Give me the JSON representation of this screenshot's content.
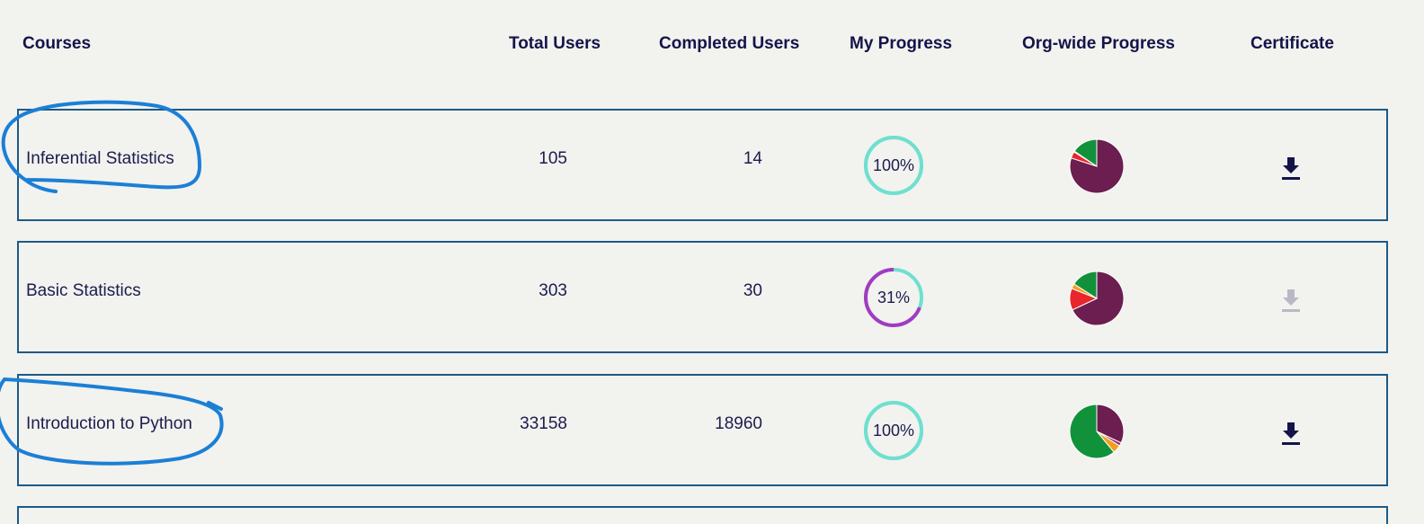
{
  "table": {
    "headers": {
      "courses": "Courses",
      "total_users": "Total Users",
      "completed_users": "Completed Users",
      "my_progress": "My Progress",
      "org_progress": "Org-wide Progress",
      "certificate": "Certificate"
    },
    "rows": [
      {
        "course": "Inferential Statistics",
        "total_users": "105",
        "completed_users": "14",
        "my_progress": "100%",
        "my_progress_value": 1.0,
        "ring_color": "#6ee0cf",
        "org_pie": [
          {
            "color": "#6b1e4f",
            "value": 0.8
          },
          {
            "color": "#e8262b",
            "value": 0.04
          },
          {
            "color": "#f0a020",
            "value": 0.005
          },
          {
            "color": "#12913b",
            "value": 0.155
          }
        ],
        "certificate_available": true
      },
      {
        "course": "Basic Statistics",
        "total_users": "303",
        "completed_users": "30",
        "my_progress": "31%",
        "my_progress_value": 0.31,
        "ring_color": "#a23bc2",
        "org_pie": [
          {
            "color": "#6b1e4f",
            "value": 0.68
          },
          {
            "color": "#e8262b",
            "value": 0.13
          },
          {
            "color": "#f0a020",
            "value": 0.03
          },
          {
            "color": "#12913b",
            "value": 0.16
          }
        ],
        "certificate_available": false
      },
      {
        "course": "Introduction to Python",
        "total_users": "33158",
        "completed_users": "18960",
        "my_progress": "100%",
        "my_progress_value": 1.0,
        "ring_color": "#6ee0cf",
        "org_pie": [
          {
            "color": "#6b1e4f",
            "value": 0.32
          },
          {
            "color": "#9b2a6a",
            "value": 0.02
          },
          {
            "color": "#f0a020",
            "value": 0.05
          },
          {
            "color": "#12913b",
            "value": 0.61
          }
        ],
        "certificate_available": true
      }
    ]
  },
  "colors": {
    "header_text": "#14144a",
    "row_border": "#1d5a86",
    "annotation": "#1b7fd6",
    "download_active": "#14144a",
    "download_disabled": "#b9b9c6"
  },
  "icons": {
    "certificate": "download-icon"
  }
}
